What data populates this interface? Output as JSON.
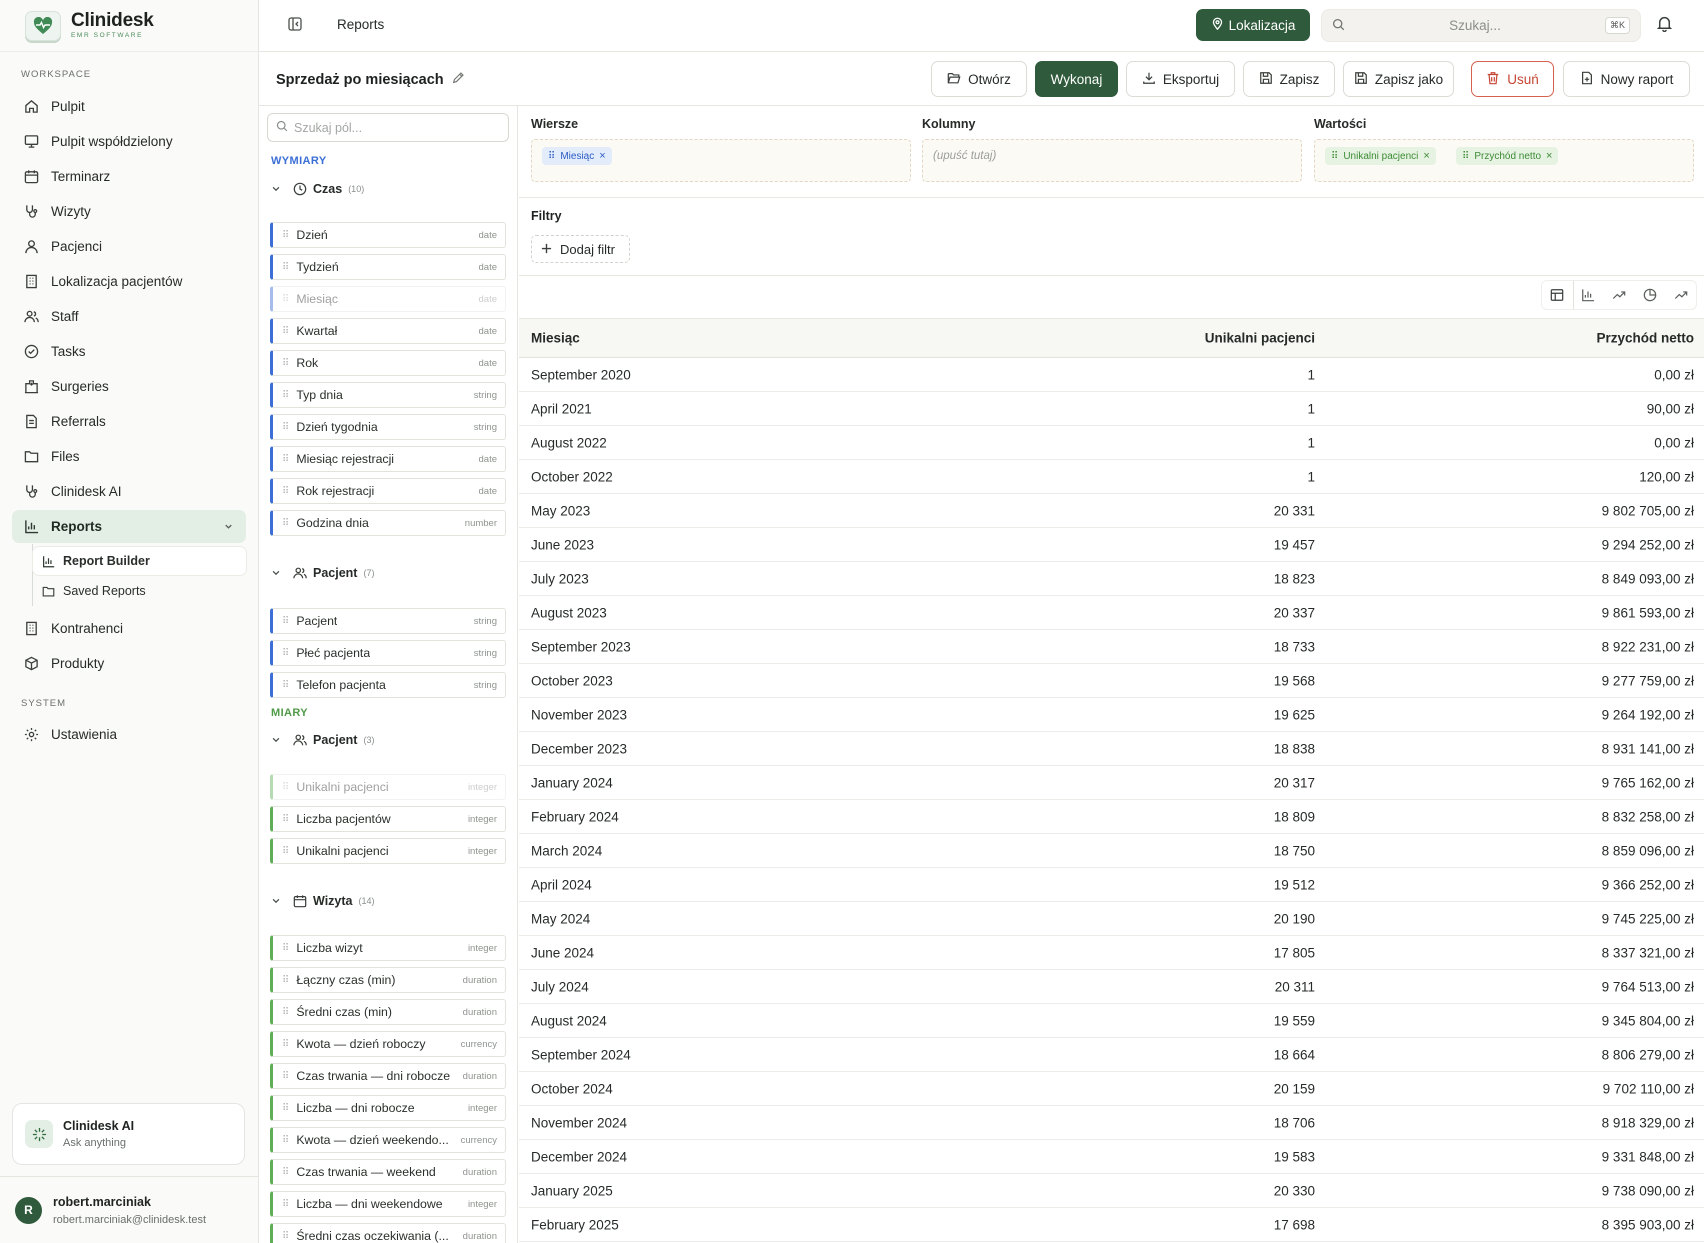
{
  "brand": {
    "name": "Clinidesk",
    "tagline": "EMR SOFTWARE"
  },
  "sidebar": {
    "section_workspace": "WORKSPACE",
    "section_system": "SYSTEM",
    "items": [
      {
        "label": "Pulpit",
        "icon": "home-icon"
      },
      {
        "label": "Pulpit współdzielony",
        "icon": "monitor-icon"
      },
      {
        "label": "Terminarz",
        "icon": "calendar-icon"
      },
      {
        "label": "Wizyty",
        "icon": "stethoscope-icon"
      },
      {
        "label": "Pacjenci",
        "icon": "user-icon"
      },
      {
        "label": "Lokalizacja pacjentów",
        "icon": "building-icon"
      },
      {
        "label": "Staff",
        "icon": "users-icon"
      },
      {
        "label": "Tasks",
        "icon": "check-circle-icon"
      },
      {
        "label": "Surgeries",
        "icon": "hospital-icon"
      },
      {
        "label": "Referrals",
        "icon": "document-icon"
      },
      {
        "label": "Files",
        "icon": "folder-icon"
      },
      {
        "label": "Clinidesk AI",
        "icon": "stethoscope-icon"
      },
      {
        "label": "Reports",
        "icon": "bar-chart-icon"
      },
      {
        "label": "Kontrahenci",
        "icon": "building-icon"
      },
      {
        "label": "Produkty",
        "icon": "package-icon"
      }
    ],
    "reports_sub": [
      {
        "label": "Report Builder",
        "icon": "bar-chart-icon"
      },
      {
        "label": "Saved Reports",
        "icon": "folder-icon"
      }
    ],
    "settings": "Ustawienia",
    "ai_card": {
      "title": "Clinidesk AI",
      "subtitle": "Ask anything"
    },
    "user": {
      "initial": "R",
      "name": "robert.marciniak",
      "email": "robert.marciniak@clinidesk.test"
    }
  },
  "topbar": {
    "title": "Reports",
    "location_button": "Lokalizacja",
    "search_placeholder": "Szukaj...",
    "shortcut": "⌘K"
  },
  "report": {
    "title": "Sprzedaż po miesiącach",
    "buttons": {
      "open": "Otwórz",
      "run": "Wykonaj",
      "export": "Eksportuj",
      "save": "Zapisz",
      "save_as": "Zapisz jako",
      "delete": "Usuń",
      "new": "Nowy raport"
    }
  },
  "fields_panel": {
    "search_placeholder": "Szukaj pól...",
    "dimensions_label": "WYMIARY",
    "measures_label": "MIARY",
    "groups": {
      "czas": {
        "name": "Czas",
        "count": "(10)"
      },
      "pacjent_dim": {
        "name": "Pacjent",
        "count": "(7)"
      },
      "pacjent_meas": {
        "name": "Pacjent",
        "count": "(3)"
      },
      "wizyta": {
        "name": "Wizyta",
        "count": "(14)"
      }
    },
    "czas_fields": [
      {
        "name": "Dzień",
        "type": "date"
      },
      {
        "name": "Tydzień",
        "type": "date"
      },
      {
        "name": "Miesiąc",
        "type": "date"
      },
      {
        "name": "Kwartał",
        "type": "date"
      },
      {
        "name": "Rok",
        "type": "date"
      },
      {
        "name": "Typ dnia",
        "type": "string"
      },
      {
        "name": "Dzień tygodnia",
        "type": "string"
      },
      {
        "name": "Miesiąc rejestracji",
        "type": "date"
      },
      {
        "name": "Rok rejestracji",
        "type": "date"
      },
      {
        "name": "Godzina dnia",
        "type": "number"
      }
    ],
    "pacjent_dim_fields": [
      {
        "name": "Pacjent",
        "type": "string"
      },
      {
        "name": "Płeć pacjenta",
        "type": "string"
      },
      {
        "name": "Telefon pacjenta",
        "type": "string"
      }
    ],
    "pacjent_meas_fields": [
      {
        "name": "Unikalni pacjenci",
        "type": "integer"
      },
      {
        "name": "Liczba pacjentów",
        "type": "integer"
      },
      {
        "name": "Unikalni pacjenci",
        "type": "integer"
      }
    ],
    "wizyta_fields": [
      {
        "name": "Liczba wizyt",
        "type": "integer"
      },
      {
        "name": "Łączny czas (min)",
        "type": "duration"
      },
      {
        "name": "Średni czas (min)",
        "type": "duration"
      },
      {
        "name": "Kwota — dzień roboczy",
        "type": "currency"
      },
      {
        "name": "Czas trwania — dni robocze",
        "type": "duration"
      },
      {
        "name": "Liczba — dni robocze",
        "type": "integer"
      },
      {
        "name": "Kwota — dzień weekendo...",
        "type": "currency"
      },
      {
        "name": "Czas trwania — weekend",
        "type": "duration"
      },
      {
        "name": "Liczba — dni weekendowe",
        "type": "integer"
      },
      {
        "name": "Średni czas oczekiwania (...",
        "type": "duration"
      }
    ]
  },
  "builder": {
    "rows_label": "Wiersze",
    "columns_label": "Kolumny",
    "values_label": "Wartości",
    "rows_chip": "Miesiąc",
    "columns_placeholder": "(upuść tutaj)",
    "values_chips": [
      "Unikalni pacjenci",
      "Przychód netto"
    ],
    "filters_label": "Filtry",
    "add_filter": "Dodaj filtr"
  },
  "table": {
    "headers": [
      "Miesiąc",
      "Unikalni pacjenci",
      "Przychód netto"
    ],
    "rows": [
      [
        "September 2020",
        "1",
        "0,00 zł"
      ],
      [
        "April 2021",
        "1",
        "90,00 zł"
      ],
      [
        "August 2022",
        "1",
        "0,00 zł"
      ],
      [
        "October 2022",
        "1",
        "120,00 zł"
      ],
      [
        "May 2023",
        "20 331",
        "9 802 705,00 zł"
      ],
      [
        "June 2023",
        "19 457",
        "9 294 252,00 zł"
      ],
      [
        "July 2023",
        "18 823",
        "8 849 093,00 zł"
      ],
      [
        "August 2023",
        "20 337",
        "9 861 593,00 zł"
      ],
      [
        "September 2023",
        "18 733",
        "8 922 231,00 zł"
      ],
      [
        "October 2023",
        "19 568",
        "9 277 759,00 zł"
      ],
      [
        "November 2023",
        "19 625",
        "9 264 192,00 zł"
      ],
      [
        "December 2023",
        "18 838",
        "8 931 141,00 zł"
      ],
      [
        "January 2024",
        "20 317",
        "9 765 162,00 zł"
      ],
      [
        "February 2024",
        "18 809",
        "8 832 258,00 zł"
      ],
      [
        "March 2024",
        "18 750",
        "8 859 096,00 zł"
      ],
      [
        "April 2024",
        "19 512",
        "9 366 252,00 zł"
      ],
      [
        "May 2024",
        "20 190",
        "9 745 225,00 zł"
      ],
      [
        "June 2024",
        "17 805",
        "8 337 321,00 zł"
      ],
      [
        "July 2024",
        "20 311",
        "9 764 513,00 zł"
      ],
      [
        "August 2024",
        "19 559",
        "9 345 804,00 zł"
      ],
      [
        "September 2024",
        "18 664",
        "8 806 279,00 zł"
      ],
      [
        "October 2024",
        "20 159",
        "9 702 110,00 zł"
      ],
      [
        "November 2024",
        "18 706",
        "8 918 329,00 zł"
      ],
      [
        "December 2024",
        "19 583",
        "9 331 848,00 zł"
      ],
      [
        "January 2025",
        "20 330",
        "9 738 090,00 zł"
      ],
      [
        "February 2025",
        "17 698",
        "8 395 903,00 zł"
      ]
    ]
  },
  "colors": {
    "brand_green": "#2f5a3b",
    "dimension_blue": "#3b6fd6",
    "measure_green": "#5fae57",
    "danger_red": "#c64533"
  }
}
